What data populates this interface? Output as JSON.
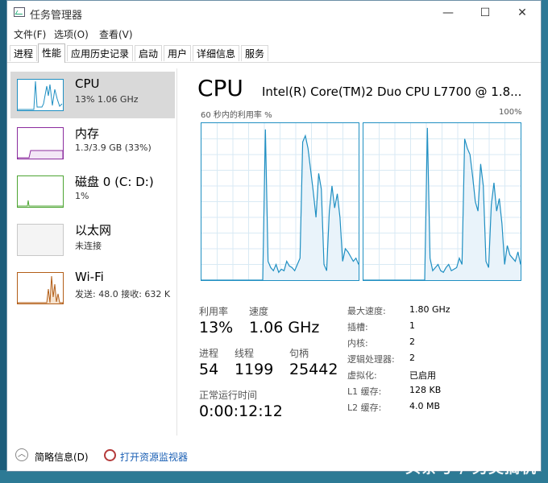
{
  "window": {
    "title": "任务管理器",
    "minimize": "—",
    "maximize": "☐",
    "close": "✕"
  },
  "menu": {
    "file": "文件(F)",
    "options": "选项(O)",
    "view": "查看(V)"
  },
  "tabs": [
    "进程",
    "性能",
    "应用历史记录",
    "启动",
    "用户",
    "详细信息",
    "服务"
  ],
  "active_tab": "性能",
  "sidebar": {
    "items": [
      {
        "name": "CPU",
        "sub": "13% 1.06 GHz",
        "color": "#1f8fc2",
        "selected": true
      },
      {
        "name": "内存",
        "sub": "1.3/3.9 GB (33%)",
        "color": "#8b2c9e"
      },
      {
        "name": "磁盘 0 (C: D:)",
        "sub": "1%",
        "color": "#4da532"
      },
      {
        "name": "以太网",
        "sub": "未连接",
        "color": "#c8c8c8"
      },
      {
        "name": "Wi-Fi",
        "sub": "发送: 48.0  接收: 632 K",
        "color": "#b25d17"
      }
    ]
  },
  "main": {
    "title": "CPU",
    "model": "Intel(R) Core(TM)2 Duo CPU L7700 @ 1.8...",
    "graph_label_left": "60 秒内的利用率 %",
    "graph_label_right": "100%",
    "stats": {
      "utilization_label": "利用率",
      "utilization": "13%",
      "speed_label": "速度",
      "speed": "1.06 GHz",
      "processes_label": "进程",
      "processes": "54",
      "threads_label": "线程",
      "threads": "1199",
      "handles_label": "句柄",
      "handles": "25442",
      "uptime_label": "正常运行时间",
      "uptime": "0:00:12:12"
    },
    "specs": [
      {
        "label": "最大速度:",
        "value": "1.80 GHz"
      },
      {
        "label": "插槽:",
        "value": "1"
      },
      {
        "label": "内核:",
        "value": "2"
      },
      {
        "label": "逻辑处理器:",
        "value": "2"
      },
      {
        "label": "虚拟化:",
        "value": "已启用"
      },
      {
        "label": "L1 缓存:",
        "value": "128 KB"
      },
      {
        "label": "L2 缓存:",
        "value": "4.0 MB"
      }
    ]
  },
  "footer": {
    "fewer_details": "简略信息(D)",
    "open_monitor": "打开资源监视器"
  },
  "watermark": "头条号 / 另类搞机",
  "cpu_graphs": [
    [
      0,
      0,
      0,
      0,
      0,
      0,
      0,
      0,
      0,
      0,
      0,
      0,
      0,
      0,
      0,
      0,
      0,
      0,
      0,
      0,
      0,
      0,
      0,
      0,
      96,
      12,
      8,
      6,
      10,
      5,
      7,
      6,
      12,
      9,
      8,
      6,
      10,
      14,
      88,
      92,
      84,
      70,
      56,
      40,
      68,
      58,
      10,
      6,
      44,
      60,
      46,
      55,
      40,
      12,
      20,
      18,
      15,
      12,
      14,
      10
    ],
    [
      0,
      0,
      0,
      0,
      0,
      0,
      0,
      0,
      0,
      0,
      0,
      0,
      0,
      0,
      0,
      0,
      0,
      0,
      0,
      0,
      0,
      0,
      0,
      0,
      97,
      14,
      6,
      8,
      10,
      6,
      5,
      8,
      10,
      6,
      7,
      8,
      14,
      10,
      90,
      84,
      80,
      66,
      50,
      44,
      74,
      60,
      12,
      8,
      48,
      62,
      44,
      52,
      36,
      10,
      22,
      16,
      14,
      12,
      18,
      10
    ]
  ]
}
